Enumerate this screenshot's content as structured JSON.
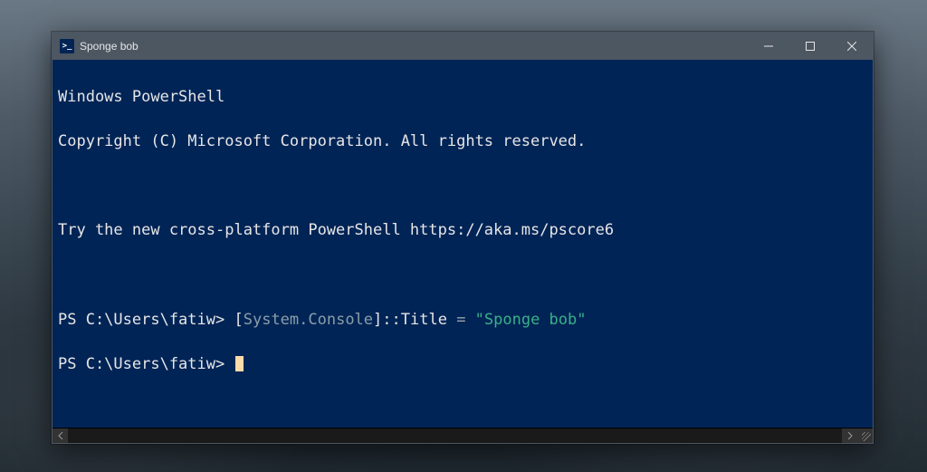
{
  "window": {
    "title": "Sponge bob",
    "icon_glyph": ">_"
  },
  "terminal": {
    "header1": "Windows PowerShell",
    "header2": "Copyright (C) Microsoft Corporation. All rights reserved.",
    "tip": "Try the new cross-platform PowerShell https://aka.ms/pscore6",
    "prompt": "PS C:\\Users\\fatiw>",
    "cmd": {
      "open_bracket": "[",
      "type": "System.Console",
      "close_bracket": "]",
      "accessor": "::",
      "property": "Title",
      "equals": " = ",
      "string": "\"Sponge bob\""
    }
  }
}
